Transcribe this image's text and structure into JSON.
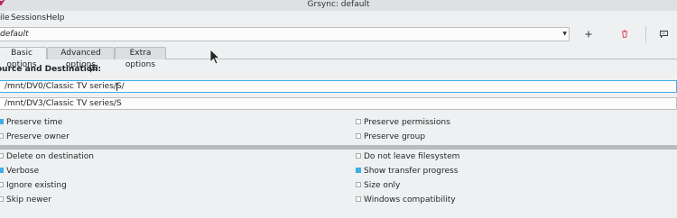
{
  "window": {
    "title": "Grsync: default"
  },
  "menu": {
    "file": "ile",
    "sessions": "Sessions",
    "help": "Help"
  },
  "profile": {
    "value": "default"
  },
  "tabs": [
    {
      "label": "Basic options"
    },
    {
      "label": "Advanced options"
    },
    {
      "label": "Extra options"
    }
  ],
  "section": {
    "title": "ource and Destination:"
  },
  "source": {
    "value": "/mnt/DV0/Classic TV series/S/"
  },
  "destination": {
    "value": "/mnt/DV3/Classic TV series/S"
  },
  "options_top": {
    "preserve_time": {
      "label": "Preserve time",
      "checked": true
    },
    "preserve_owner": {
      "label": "Preserve owner",
      "checked": false
    },
    "preserve_permissions": {
      "label": "Preserve permissions",
      "checked": false
    },
    "preserve_group": {
      "label": "Preserve group",
      "checked": false
    }
  },
  "options_bottom": {
    "delete_on_destination": {
      "label": "Delete on destination",
      "checked": false
    },
    "verbose": {
      "label": "Verbose",
      "checked": true
    },
    "ignore_existing": {
      "label": "Ignore existing",
      "checked": false
    },
    "skip_newer": {
      "label": "Skip newer",
      "checked": false
    },
    "do_not_leave_filesystem": {
      "label": "Do not leave filesystem",
      "checked": false
    },
    "show_transfer_progress": {
      "label": "Show transfer progress",
      "checked": true
    },
    "size_only": {
      "label": "Size only",
      "checked": false
    },
    "windows_compatibility": {
      "label": "Windows compatibility",
      "checked": false
    }
  },
  "colors": {
    "accent": "#3daee9",
    "delete_red": "#da4453",
    "app_icon": "#c2185b"
  },
  "icons": [
    "app-icon",
    "add-icon",
    "delete-icon",
    "comment-icon",
    "info-icon",
    "mouse-cursor"
  ]
}
